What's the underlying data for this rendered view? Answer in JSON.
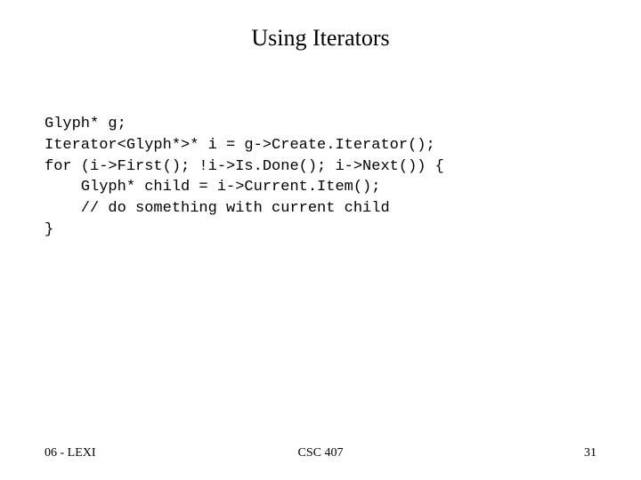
{
  "slide": {
    "title": "Using Iterators",
    "code": "Glyph* g;\nIterator<Glyph*>* i = g->Create.Iterator();\nfor (i->First(); !i->Is.Done(); i->Next()) {\n    Glyph* child = i->Current.Item();\n    // do something with current child\n}",
    "footer": {
      "left": "06 - LEXI",
      "center": "CSC 407",
      "right": "31"
    }
  }
}
